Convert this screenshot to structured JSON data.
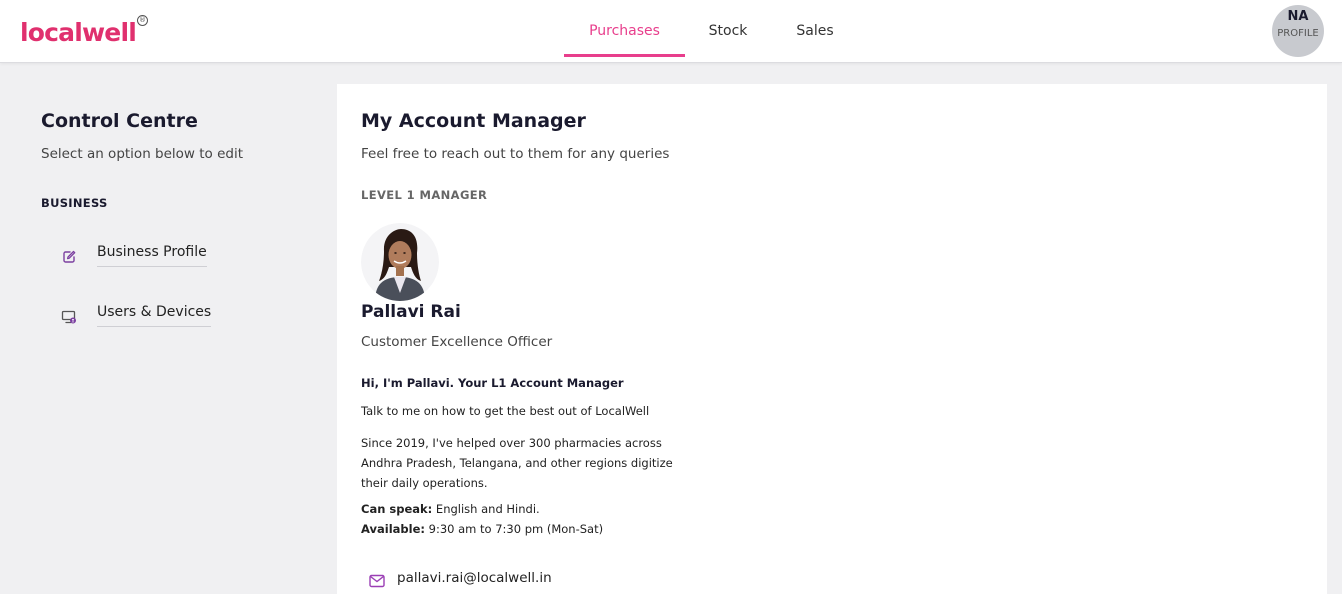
{
  "brand": {
    "logo_text": "localwell",
    "reg_mark": "®",
    "accent_color": "#e83e8c"
  },
  "nav": {
    "tabs": [
      {
        "label": "Purchases",
        "active": true
      },
      {
        "label": "Stock",
        "active": false
      },
      {
        "label": "Sales",
        "active": false
      }
    ]
  },
  "profile": {
    "initials": "NA",
    "label": "PROFILE"
  },
  "sidebar": {
    "title": "Control Centre",
    "subtitle": "Select an option below to edit",
    "section": "BUSINESS",
    "items": [
      {
        "label": "Business Profile",
        "icon": "edit-icon"
      },
      {
        "label": "Users & Devices",
        "icon": "monitor-user-icon"
      }
    ]
  },
  "main": {
    "title": "My Account Manager",
    "subtitle": "Feel free to reach out to them for any queries",
    "level": "LEVEL 1 MANAGER",
    "manager": {
      "name": "Pallavi Rai",
      "role": "Customer Excellence Officer",
      "intro": "Hi, I'm Pallavi. Your L1 Account Manager",
      "para1": "Talk to me on how to get the best out of LocalWell",
      "para2": "Since 2019, I've helped over 300 pharmacies across Andhra Pradesh, Telangana, and other regions digitize their daily operations.",
      "languages_label": "Can speak:",
      "languages": " English and Hindi.",
      "availability_label": "Available:",
      "availability": " 9:30 am to 7:30 pm (Mon-Sat)",
      "email": "pallavi.rai@localwell.in"
    }
  }
}
